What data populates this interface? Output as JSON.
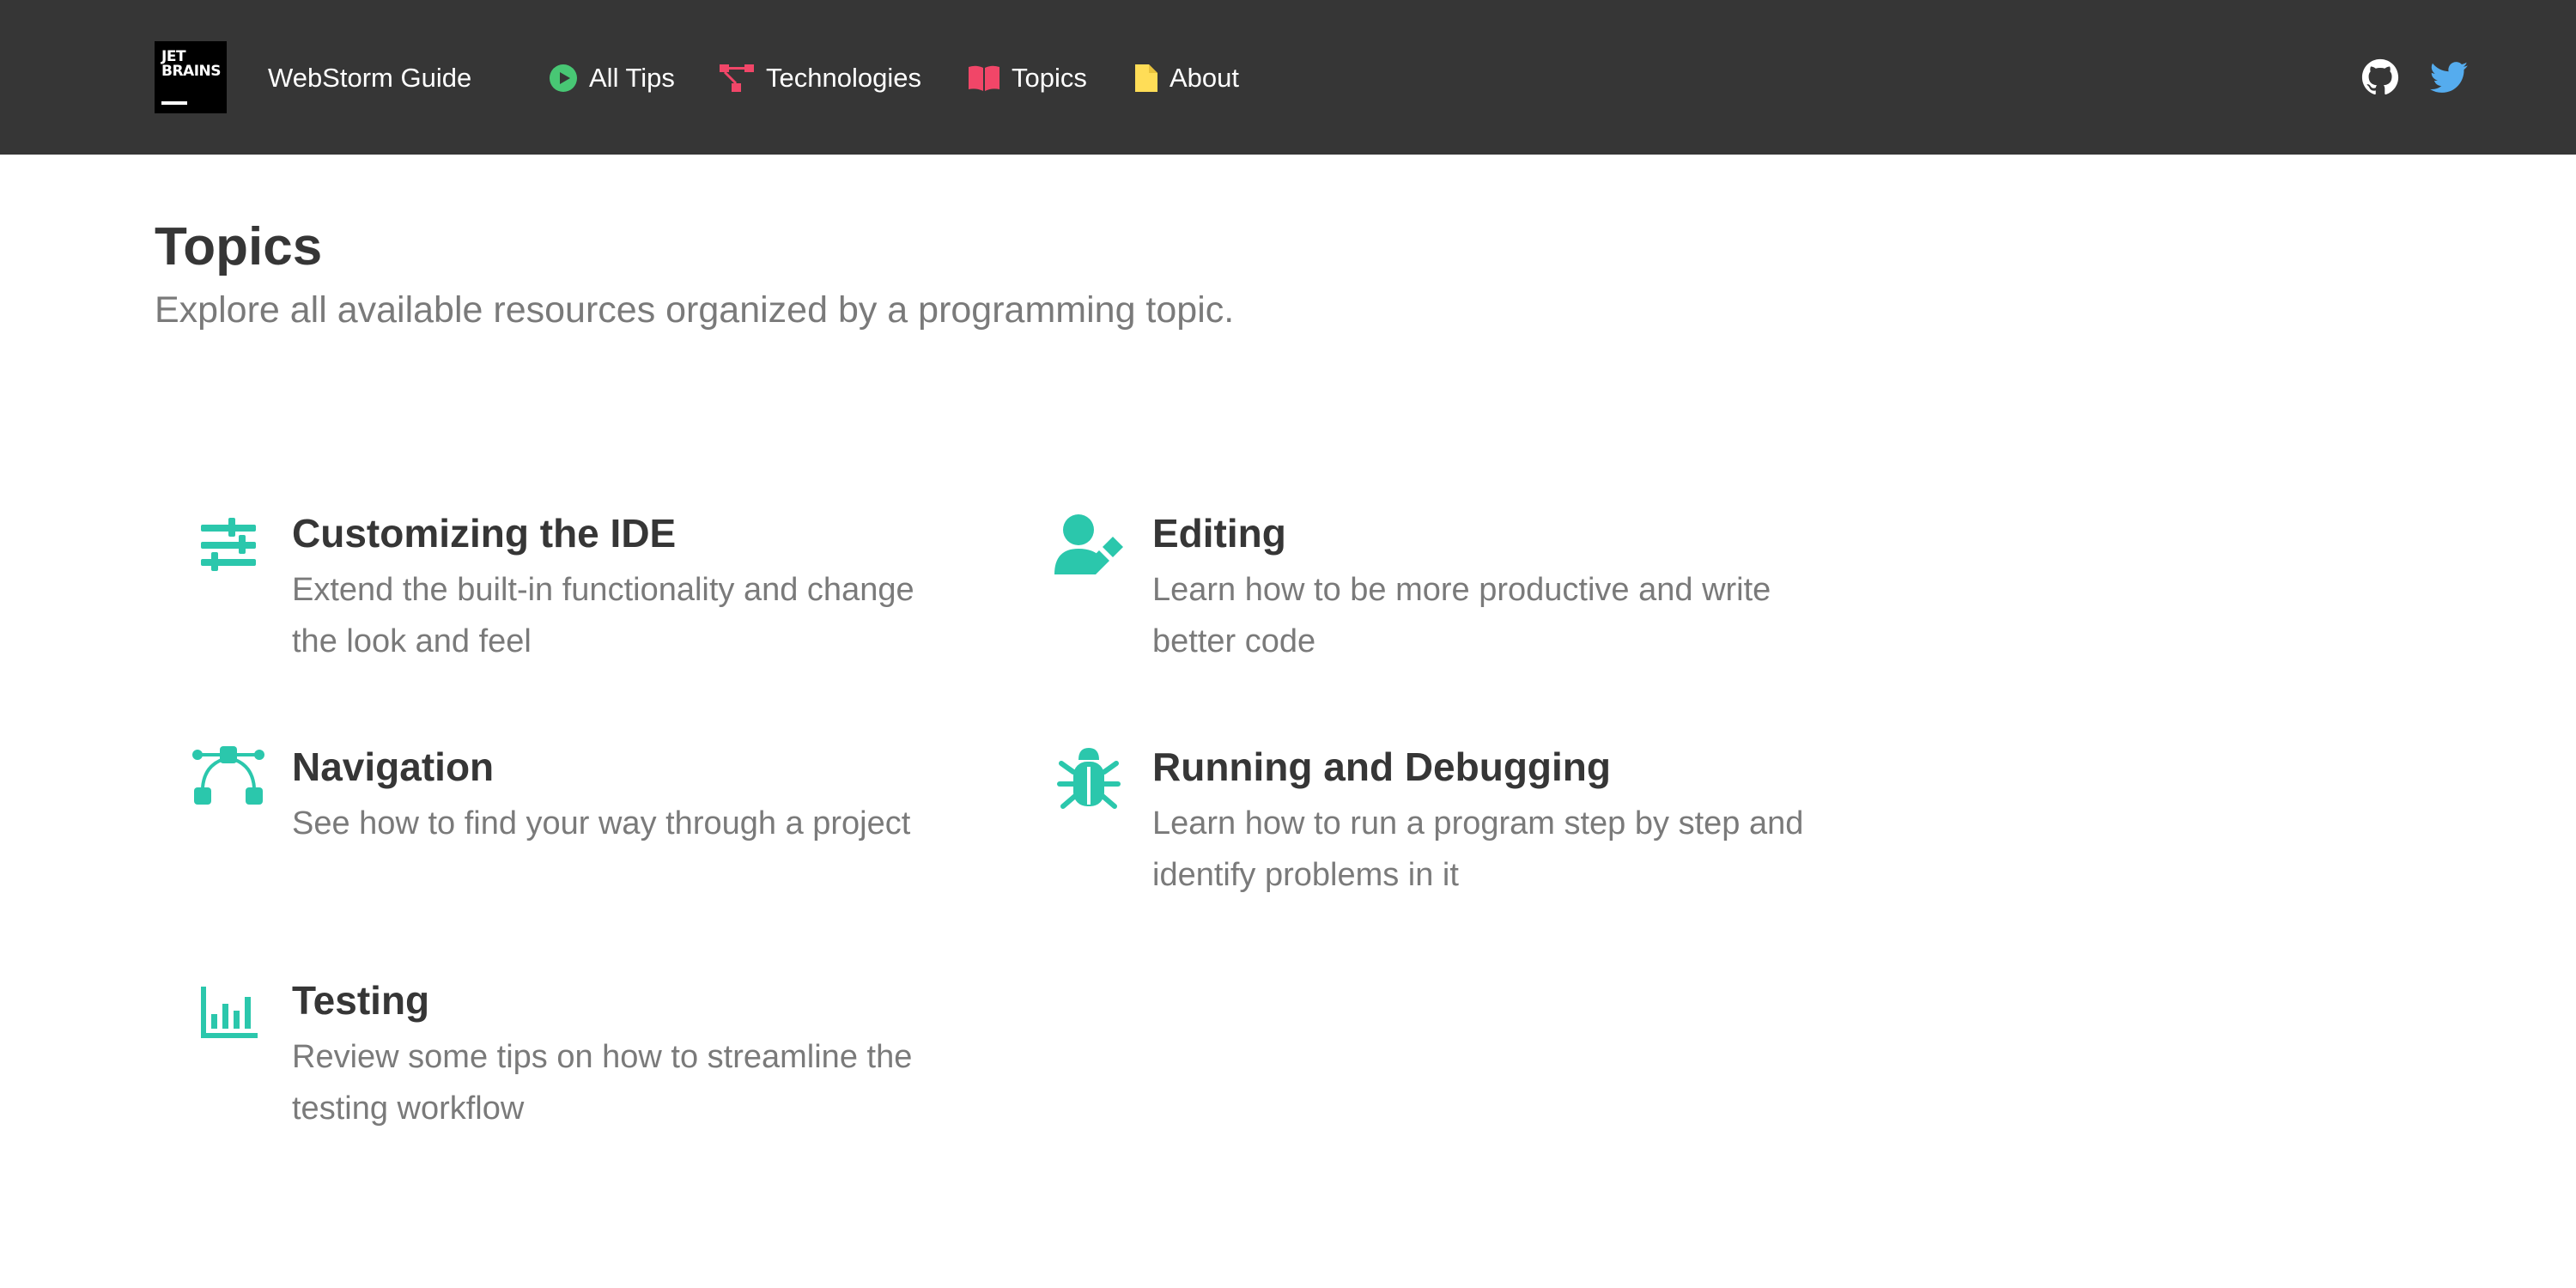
{
  "header": {
    "logo_line1": "JET",
    "logo_line2": "BRAINS",
    "brand": "WebStorm Guide",
    "nav": [
      {
        "label": "All Tips",
        "icon": "play-circle-icon",
        "color": "#48c774"
      },
      {
        "label": "Technologies",
        "icon": "sitemap-icon",
        "color": "#f14668"
      },
      {
        "label": "Topics",
        "icon": "book-open-icon",
        "color": "#f14668"
      },
      {
        "label": "About",
        "icon": "file-icon",
        "color": "#ffdd57"
      }
    ],
    "social": [
      {
        "icon": "github-icon",
        "color": "#ffffff"
      },
      {
        "icon": "twitter-icon",
        "color": "#55acee"
      }
    ]
  },
  "main": {
    "title": "Topics",
    "subtitle": "Explore all available resources organized by a programming topic.",
    "accent": "#2bc7ac",
    "topics": [
      {
        "title": "Customizing the IDE",
        "description": "Extend the built-in functionality and change the look and feel",
        "icon": "sliders-icon"
      },
      {
        "title": "Editing",
        "description": "Learn how to be more productive and write better code",
        "icon": "user-edit-icon"
      },
      {
        "title": "Navigation",
        "description": "See how to find your way through a project",
        "icon": "bezier-curve-icon"
      },
      {
        "title": "Running and Debugging",
        "description": "Learn how to run a program step by step and identify problems in it",
        "icon": "bug-icon"
      },
      {
        "title": "Testing",
        "description": "Review some tips on how to streamline the testing workflow",
        "icon": "chart-bar-icon"
      }
    ]
  }
}
